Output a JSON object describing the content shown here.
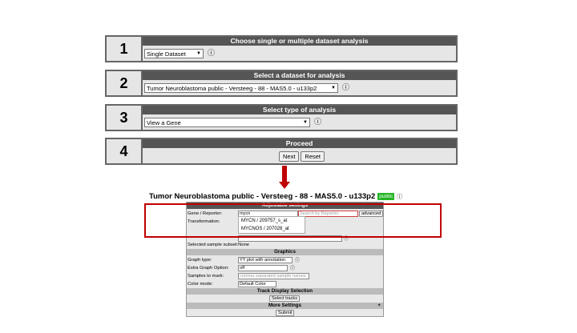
{
  "steps": [
    {
      "num": "1",
      "title": "Choose single or multiple dataset analysis",
      "select": "Single Dataset"
    },
    {
      "num": "2",
      "title": "Select a dataset for analysis",
      "select": "Tumor Neuroblastoma public - Versteeg - 88 - MAS5.0 - u133p2"
    },
    {
      "num": "3",
      "title": "Select type of analysis",
      "select": "View a Gene"
    },
    {
      "num": "4",
      "title": "Proceed",
      "next": "Next",
      "reset": "Reset"
    }
  ],
  "dataset": {
    "title": "Tumor Neuroblastoma public - Versteeg - 88 - MAS5.0 - u133p2",
    "badge": "public"
  },
  "settings": {
    "adjustable_title": "Adjustable settings",
    "gene_label": "Gene / Reporter:",
    "gene_value": "mycn",
    "search_placeholder": "Search by Reporter",
    "advanced_label": "advanced",
    "transformation_label": "Transformation:",
    "dropdown": [
      "MYCN / 209757_s_at",
      "MYCNOS / 207028_at"
    ],
    "subset_text": "Selected sample subset:None"
  },
  "graphics": {
    "title": "Graphics",
    "graph_type_label": "Graph type:",
    "graph_type_value": "YY plot with annotation",
    "extra_label": "Extra Graph Option:",
    "extra_value": "off",
    "samples_label": "Samples to mark:",
    "samples_placeholder": "comma separated sample names",
    "color_label": "Color mode:",
    "color_value": "Default Color"
  },
  "track": {
    "title": "Track Display Selection",
    "button": "Select tracks"
  },
  "more": {
    "title": "More Settings",
    "plus": "+"
  },
  "submit": "Submit",
  "colors": {
    "header": "#555555",
    "highlight": "#c00000",
    "badge": "#22b422"
  }
}
